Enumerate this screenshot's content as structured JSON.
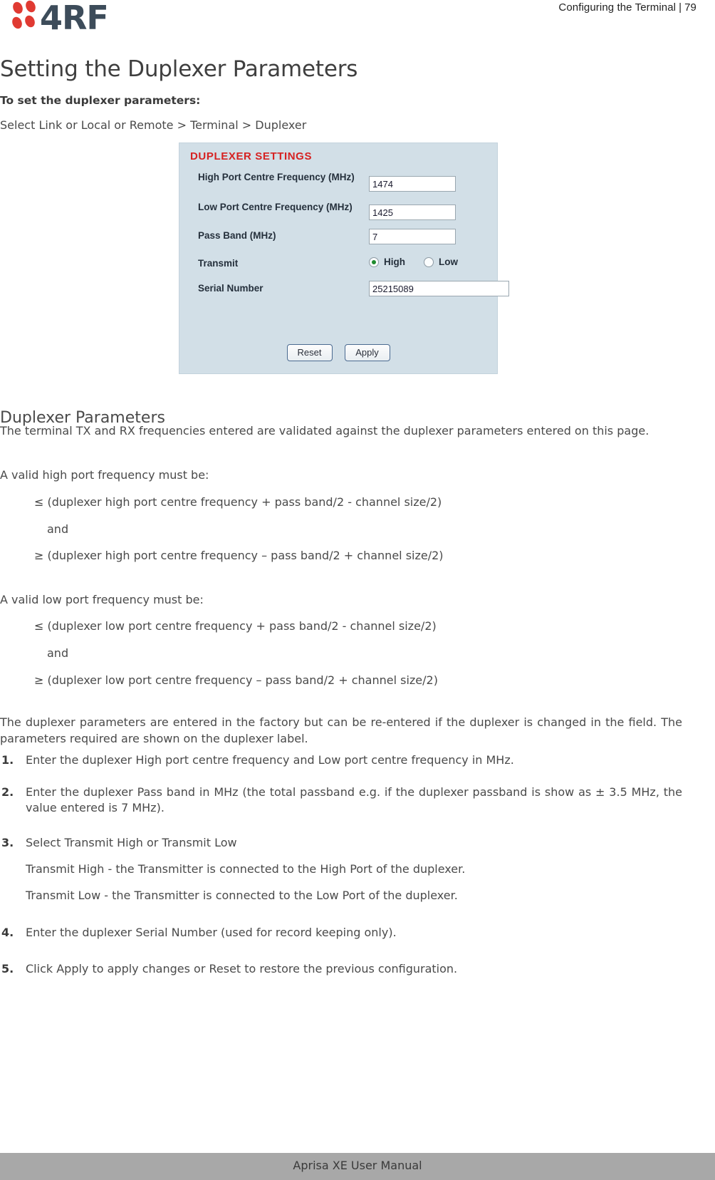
{
  "header": {
    "logo_text": "4RF",
    "breadcrumb_section": "Configuring the Terminal",
    "breadcrumb_separator": "|",
    "page_number": "79"
  },
  "page_title": "Setting the Duplexer Parameters",
  "intro": {
    "bold_line": "To set the duplexer parameters:",
    "path_line": "Select Link or Local or Remote > Terminal > Duplexer"
  },
  "screenshot": {
    "panel_title": "DUPLEXER SETTINGS",
    "title_color": "#d62222",
    "panel_bg": "#d2dfe7",
    "fields": [
      {
        "label": "High Port Centre Frequency (MHz)",
        "value": "1474"
      },
      {
        "label": "Low Port Centre Frequency (MHz)",
        "value": "1425"
      },
      {
        "label": "Pass Band (MHz)",
        "value": "7"
      },
      {
        "label": "Serial Number",
        "value": "25215089"
      }
    ],
    "transmit": {
      "label": "Transmit",
      "options": [
        {
          "label": "High",
          "selected": true
        },
        {
          "label": "Low",
          "selected": false
        }
      ]
    },
    "buttons": {
      "reset": "Reset",
      "apply": "Apply"
    }
  },
  "section": {
    "heading": "Duplexer Parameters",
    "intro_paragraph": "The terminal TX and RX frequencies entered are validated against the duplexer parameters entered on this page.",
    "high_port": {
      "lead": "A valid high port frequency must be:",
      "line1": "≤ (duplexer high port centre frequency + pass band/2 - channel size/2)",
      "conjunction": "and",
      "line2": "≥ (duplexer high port centre frequency – pass band/2 + channel size/2)"
    },
    "low_port": {
      "lead": "A valid low port frequency must be:",
      "line1": "≤ (duplexer low port centre frequency + pass band/2 - channel size/2)",
      "conjunction": "and",
      "line2": "≥ (duplexer low port centre frequency – pass band/2 + channel size/2)"
    },
    "factory_paragraph": "The duplexer parameters are entered in the factory but can be re-entered if the duplexer is changed in the field. The parameters required are shown on the duplexer label."
  },
  "steps": [
    {
      "num": "1.",
      "text": "Enter the duplexer High port centre frequency and Low port centre frequency in MHz.",
      "subs": []
    },
    {
      "num": "2.",
      "text": "Enter the duplexer Pass band in MHz (the total passband e.g. if the duplexer passband is show as ± 3.5 MHz, the value entered is 7 MHz).",
      "subs": []
    },
    {
      "num": "3.",
      "text": "Select Transmit High or Transmit Low",
      "subs": [
        "Transmit High - the Transmitter is connected to the High Port of the duplexer.",
        "Transmit Low - the Transmitter is connected to the Low Port of the duplexer."
      ]
    },
    {
      "num": "4.",
      "text": "Enter the duplexer Serial Number (used for record keeping only).",
      "subs": []
    },
    {
      "num": "5.",
      "text": "Click Apply to apply changes or Reset to restore the previous configuration.",
      "subs": []
    }
  ],
  "footer": {
    "text": "Aprisa XE User Manual",
    "bar_color": "#a8a8a8"
  }
}
